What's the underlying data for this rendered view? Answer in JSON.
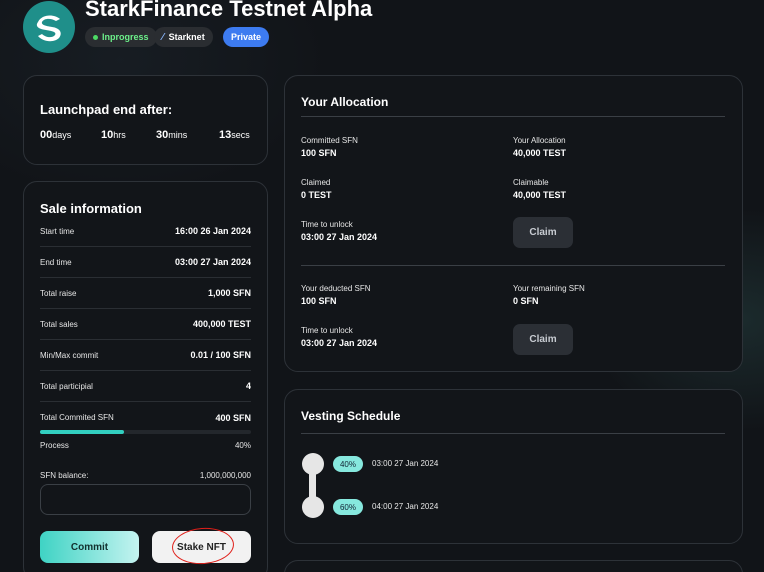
{
  "header": {
    "title": "StarkFinance Testnet Alpha",
    "status_badge": "Inprogress",
    "chain_badge": "Starknet",
    "access_badge": "Private",
    "colors": {
      "status": "#6cf08a",
      "private": "#3d7bf0",
      "accent": "#32cfc0"
    }
  },
  "countdown": {
    "title": "Launchpad end after:",
    "items": [
      {
        "value": "00",
        "unit": "days"
      },
      {
        "value": "10",
        "unit": "hrs"
      },
      {
        "value": "30",
        "unit": "mins"
      },
      {
        "value": "13",
        "unit": "secs"
      }
    ]
  },
  "sale": {
    "title": "Sale information",
    "rows": [
      {
        "label": "Start time",
        "value": "16:00 26 Jan 2024"
      },
      {
        "label": "End time",
        "value": "03:00 27 Jan 2024"
      },
      {
        "label": "Total raise",
        "value": "1,000 SFN"
      },
      {
        "label": "Total sales",
        "value": "400,000 TEST"
      },
      {
        "label": "Min/Max commit",
        "value": "0.01 / 100 SFN"
      },
      {
        "label": "Total participial",
        "value": "4"
      },
      {
        "label": "Total Commited SFN",
        "value": "400 SFN"
      }
    ],
    "process_label": "Process",
    "process_value": "40%",
    "process_fraction": 0.4,
    "balance_label": "SFN balance:",
    "balance_value": "1,000,000,000",
    "input_value": "",
    "commit_label": "Commit",
    "stake_label": "Stake NFT"
  },
  "allocation": {
    "title": "Your Allocation",
    "committed_label": "Committed SFN",
    "committed_value": "100 SFN",
    "allocation_label": "Your Allocation",
    "allocation_value": "40,000 TEST",
    "claimed_label": "Claimed",
    "claimed_value": "0 TEST",
    "claimable_label": "Claimable",
    "claimable_value": "40,000 TEST",
    "unlock1_label": "Time to unlock",
    "unlock1_value": "03:00 27 Jan 2024",
    "claim1_label": "Claim",
    "deducted_label": "Your deducted SFN",
    "deducted_value": "100 SFN",
    "remaining_label": "Your remaining SFN",
    "remaining_value": "0 SFN",
    "unlock2_label": "Time to unlock",
    "unlock2_value": "03:00 27 Jan 2024",
    "claim2_label": "Claim"
  },
  "vesting": {
    "title": "Vesting Schedule",
    "steps": [
      {
        "percent": "40%",
        "date": "03:00 27 Jan 2024"
      },
      {
        "percent": "60%",
        "date": "04:00 27 Jan 2024"
      }
    ]
  }
}
